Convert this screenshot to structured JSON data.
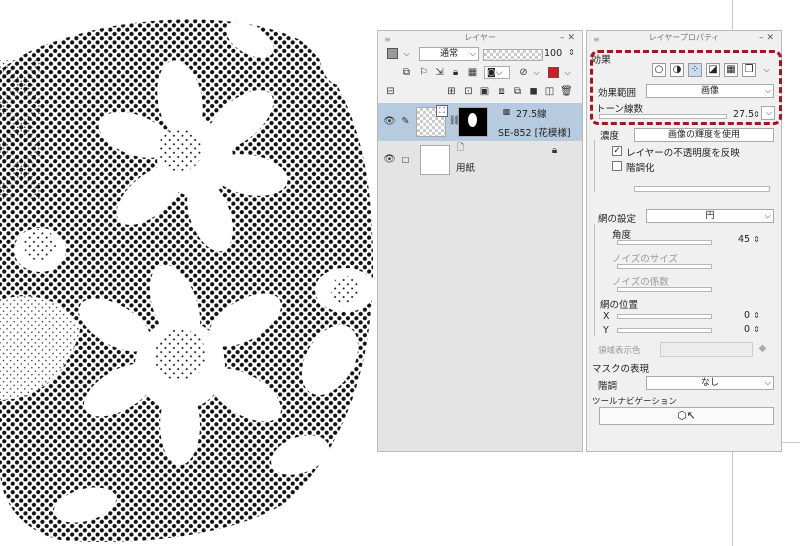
{
  "layer_panel": {
    "title": "レイヤー",
    "blend_mode": "通常",
    "opacity": "100",
    "main_color": "#cc1f1f",
    "layers": [
      {
        "value": "27.5線",
        "name": "SE-852 [花模様]"
      },
      {
        "name": "用紙"
      }
    ]
  },
  "props": {
    "title": "レイヤープロパティ",
    "effect_label": "効果",
    "effect_range_label": "効果範囲",
    "effect_range_value": "画像",
    "tone_lines_label": "トーン線数",
    "tone_lines_value": "27.5",
    "density_label": "濃度",
    "density_value": "画像の輝度を使用",
    "reflect_opacity_label": "レイヤーの不透明度を反映",
    "posterize_label": "階調化",
    "mesh_settings_label": "網の設定",
    "mesh_shape": "円",
    "angle_label": "角度",
    "angle_value": "45",
    "noise_size_label": "ノイズのサイズ",
    "noise_factor_label": "ノイズの係数",
    "mesh_position_label": "網の位置",
    "x_label": "X",
    "x_value": "0",
    "y_label": "Y",
    "y_value": "0",
    "area_color_label": "領域表示色",
    "mask_label": "マスクの表現",
    "gradation_label": "階調",
    "gradation_value": "なし",
    "tool_nav_label": "ツールナビゲーション"
  },
  "canvas": {
    "description_free": true,
    "dot_color": "#111111"
  }
}
